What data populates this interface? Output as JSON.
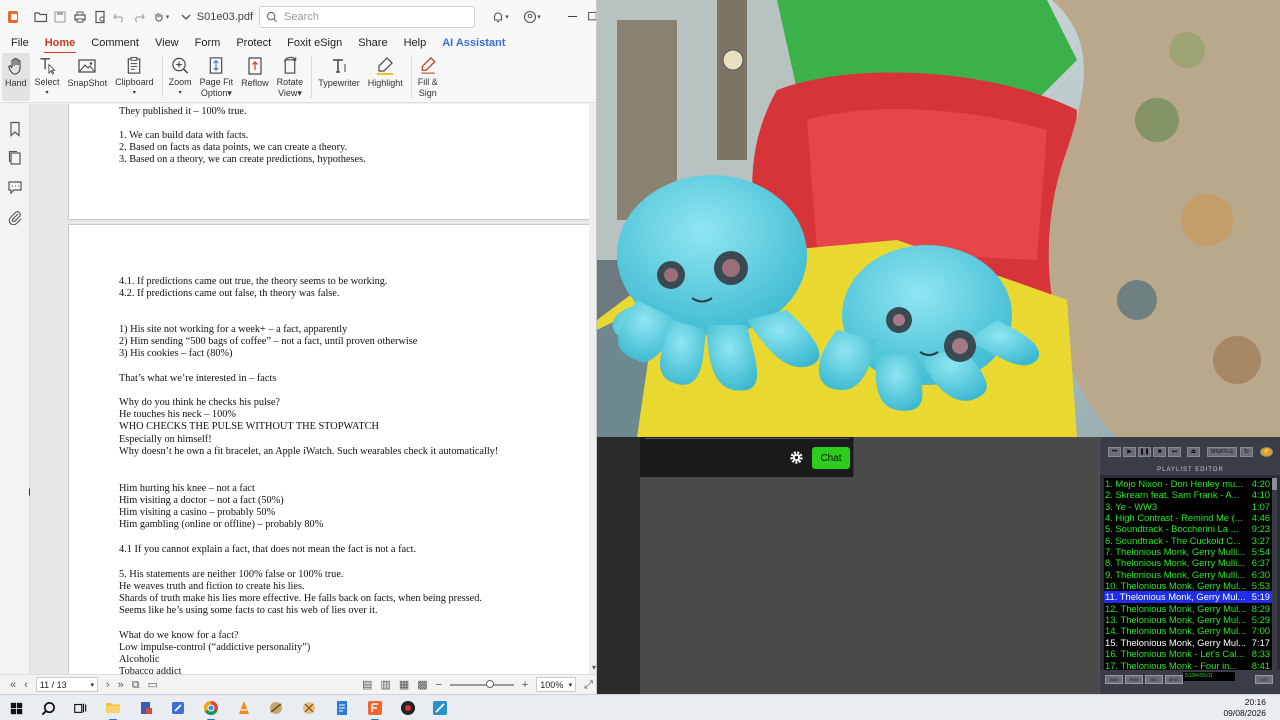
{
  "window": {
    "doc_title": "S01e03.pdf",
    "search_placeholder": "Search"
  },
  "menu": [
    "File",
    "Home",
    "Comment",
    "View",
    "Form",
    "Protect",
    "Foxit eSign",
    "Share",
    "Help",
    "AI Assistant"
  ],
  "ribbon": {
    "hand": "Hand",
    "select": "Select",
    "snapshot": "SnapShot",
    "clipboard": "Clipboard",
    "zoom": "Zoom",
    "page_fit_1": "Page Fit",
    "page_fit_2": "Option",
    "reflow": "Reflow",
    "rotate_1": "Rotate",
    "rotate_2": "View",
    "typewriter": "Typewriter",
    "highlight": "Highlight",
    "fill_sign_1": "Fill &",
    "fill_sign_2": "Sign"
  },
  "page_a_lines": [
    "They published it – 100% true.",
    "",
    "1. We can build data with facts.",
    "2. Based on facts as data points, we can create a theory.",
    "3. Based on a theory, we can create predictions, hypotheses."
  ],
  "page_b_lines": [
    "4.1. If predictions came out true, the theory seems to be working.",
    "4.2. If predictions came out false, th theory was false.",
    "",
    "",
    "1) His site not working for a week+ – a fact, apparently",
    "2) Him sending “500 bags of coffee” – not a fact, until proven otherwise",
    "3) His cookies – fact (80%)",
    "",
    "That’s what we’re interested in – facts",
    "",
    "Why do you think he checks his pulse?",
    "He touches his neck – 100%",
    "WHO CHECKS THE PULSE WITHOUT THE STOPWATCH",
    "Especially on himself!",
    "Why doesn’t he own a fit bracelet, an Apple iWatch. Such wearables check it automatically!",
    "",
    "",
    "Him hurting his knee – not a fact",
    "Him visiting a doctor – not a fact (50%)",
    "Him visiting a casino – probably 50%",
    "Him gambling (online or offline) – probably 80%",
    "",
    "4.1 If you cannot explain a fact, that does not mean the fact is not a fact.",
    "",
    "5. His statements are neither 100% false or 100% true.",
    "He weaves truth and fiction to create his lies.",
    "Shards of truth make his lies more effective. He falls back on facts, when being pressed.",
    "Seems like he’s using some facts to cast his web of lies over it.",
    "",
    "What do we know for a fact?",
    "Low impulse-control (“addictive personality”)",
    "Alcoholic",
    "Tobacco addict"
  ],
  "statusbar": {
    "page": "11 / 13",
    "zoom": "100%"
  },
  "chat": {
    "button": "Chat"
  },
  "winamp": {
    "playlist_title": "PLAYLIST EDITOR",
    "shuffle": "SHUFFLE",
    "tracks": [
      {
        "title": "1. Mojo Nixon - Don Henley mu...",
        "dur": "4:20"
      },
      {
        "title": "2. Skrearn feat. Sam Frank - A...",
        "dur": "4:10"
      },
      {
        "title": "3. Ye - WW3",
        "dur": "1:07"
      },
      {
        "title": "4. High Contrast - Remind Me (...",
        "dur": "4:46"
      },
      {
        "title": "5. Soundtrack - Boccherini La ...",
        "dur": "9:23"
      },
      {
        "title": "6. Soundtrack - The Cuckold C...",
        "dur": "3:27"
      },
      {
        "title": "7. Thelonious Monk, Gerry Mulli...",
        "dur": "5:54"
      },
      {
        "title": "8. Thelonious Monk, Gerry Mulli...",
        "dur": "6:37"
      },
      {
        "title": "9. Thelonious Monk, Gerry Mulli...",
        "dur": "6:30"
      },
      {
        "title": "10. Thelonious Monk, Gerry Mul...",
        "dur": "5:53"
      },
      {
        "title": "11. Thelonious Monk, Gerry Mul...",
        "dur": "5:19"
      },
      {
        "title": "12. Thelonious Monk, Gerry Mul...",
        "dur": "8:29"
      },
      {
        "title": "13. Thelonious Monk, Gerry Mul...",
        "dur": "5:29"
      },
      {
        "title": "14. Thelonious Monk, Gerry Mul...",
        "dur": "7:00"
      },
      {
        "title": "15. Thelonious Monk, Gerry Mul...",
        "dur": "7:17"
      },
      {
        "title": "16. Thelonious Monk - Let's Cal...",
        "dur": "8:33"
      },
      {
        "title": "17. Thelonious Monk - Four in...",
        "dur": "8:41"
      }
    ],
    "selected_index": 10,
    "current_index": 14,
    "buttons": [
      "ADD",
      "REM",
      "SEL",
      "MISC",
      "LIST"
    ],
    "time": "5:19/4:55:01"
  },
  "clock": {
    "time": "20:16",
    "date": "09/08/2026"
  },
  "colors": {
    "foxit_accent": "#c43c1c",
    "ai_blue": "#3a6fd8",
    "chat_green": "#2ecc1c",
    "winamp_green": "#29e62a",
    "winamp_select": "#1f2ee8"
  }
}
